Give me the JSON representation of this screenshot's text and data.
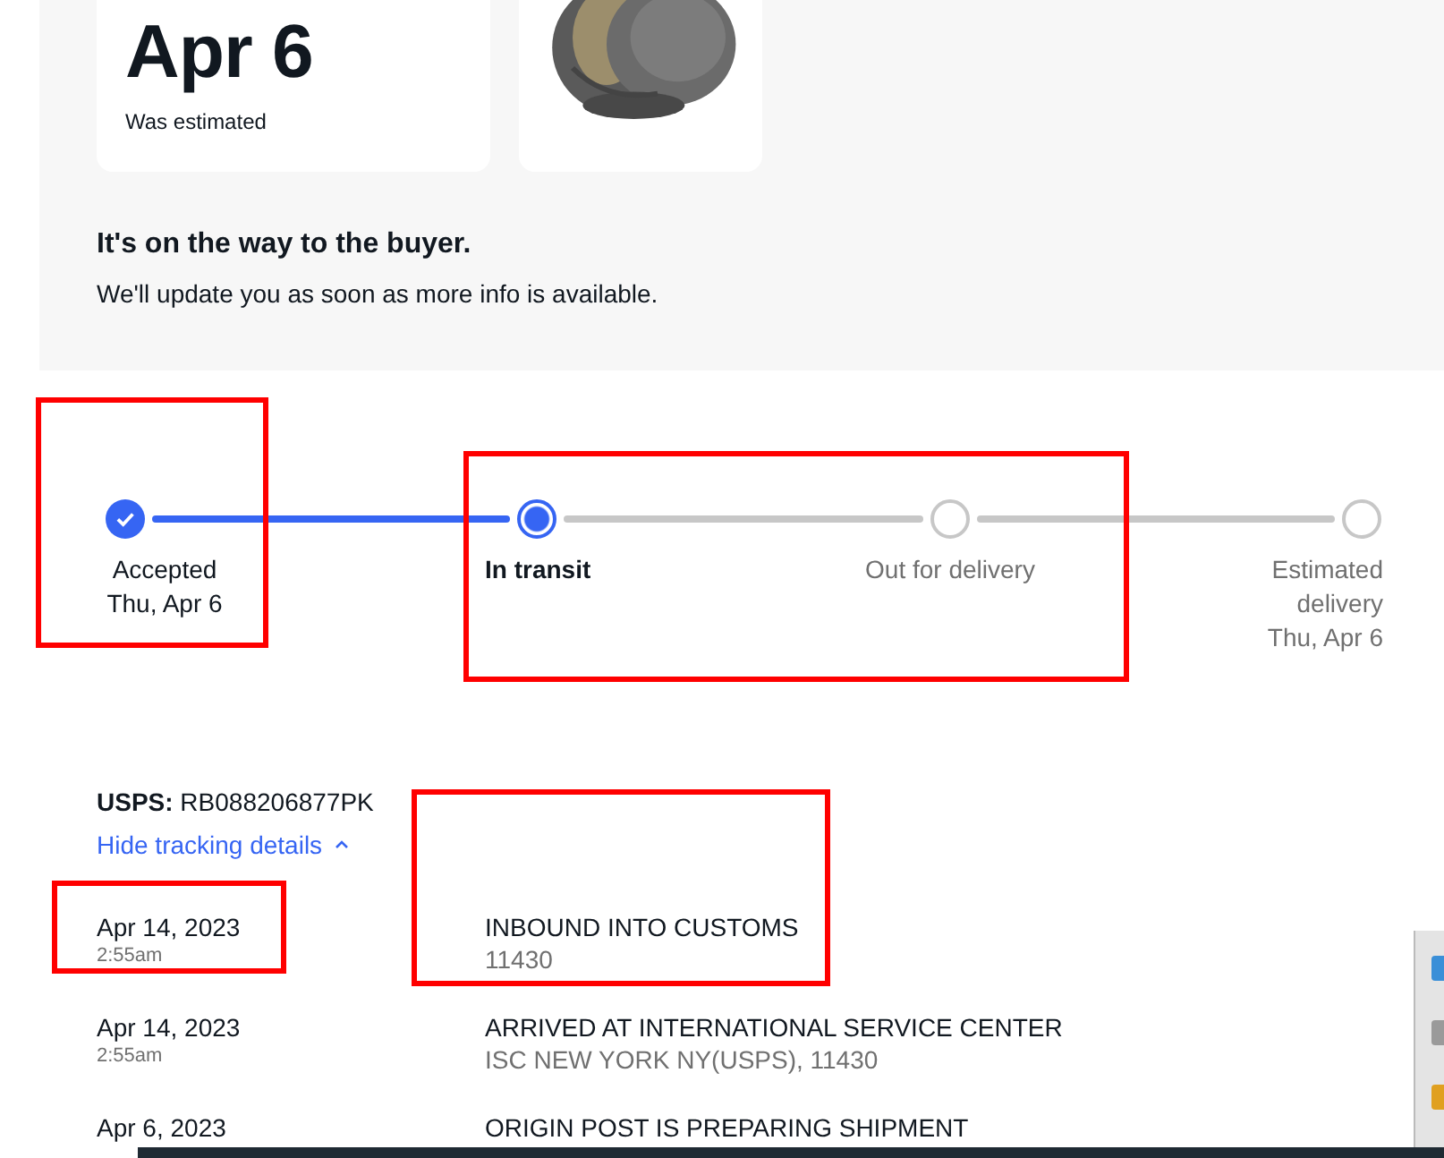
{
  "summary": {
    "date": "Apr 6",
    "date_note": "Was estimated"
  },
  "status": {
    "heading": "It's on the way to the buyer.",
    "message": "We'll update you as soon as more info is available."
  },
  "progress": [
    {
      "kind": "done",
      "label": "Accepted",
      "date": "Thu, Apr 6"
    },
    {
      "kind": "current",
      "label": "In transit"
    },
    {
      "kind": "pending",
      "label": "Out for delivery"
    },
    {
      "kind": "pending",
      "label": "Estimated delivery",
      "date": "Thu, Apr 6"
    }
  ],
  "tracking": {
    "carrier": "**USPS:** RB088206877PK",
    "toggle": "Hide tracking details",
    "expanded": true,
    "events": [
      {
        "date": "Apr 14, 2023",
        "time": "2:55am",
        "event": "INBOUND INTO CUSTOMS",
        "location": "11430"
      },
      {
        "date": "Apr 14, 2023",
        "time": "2:55am",
        "event": "ARRIVED AT INTERNATIONAL SERVICE CENTER",
        "location": "ISC NEW YORK NY(USPS), 11430"
      },
      {
        "date": "Apr 6, 2023",
        "event": "ORIGIN POST IS PREPARING SHIPMENT"
      }
    ]
  }
}
